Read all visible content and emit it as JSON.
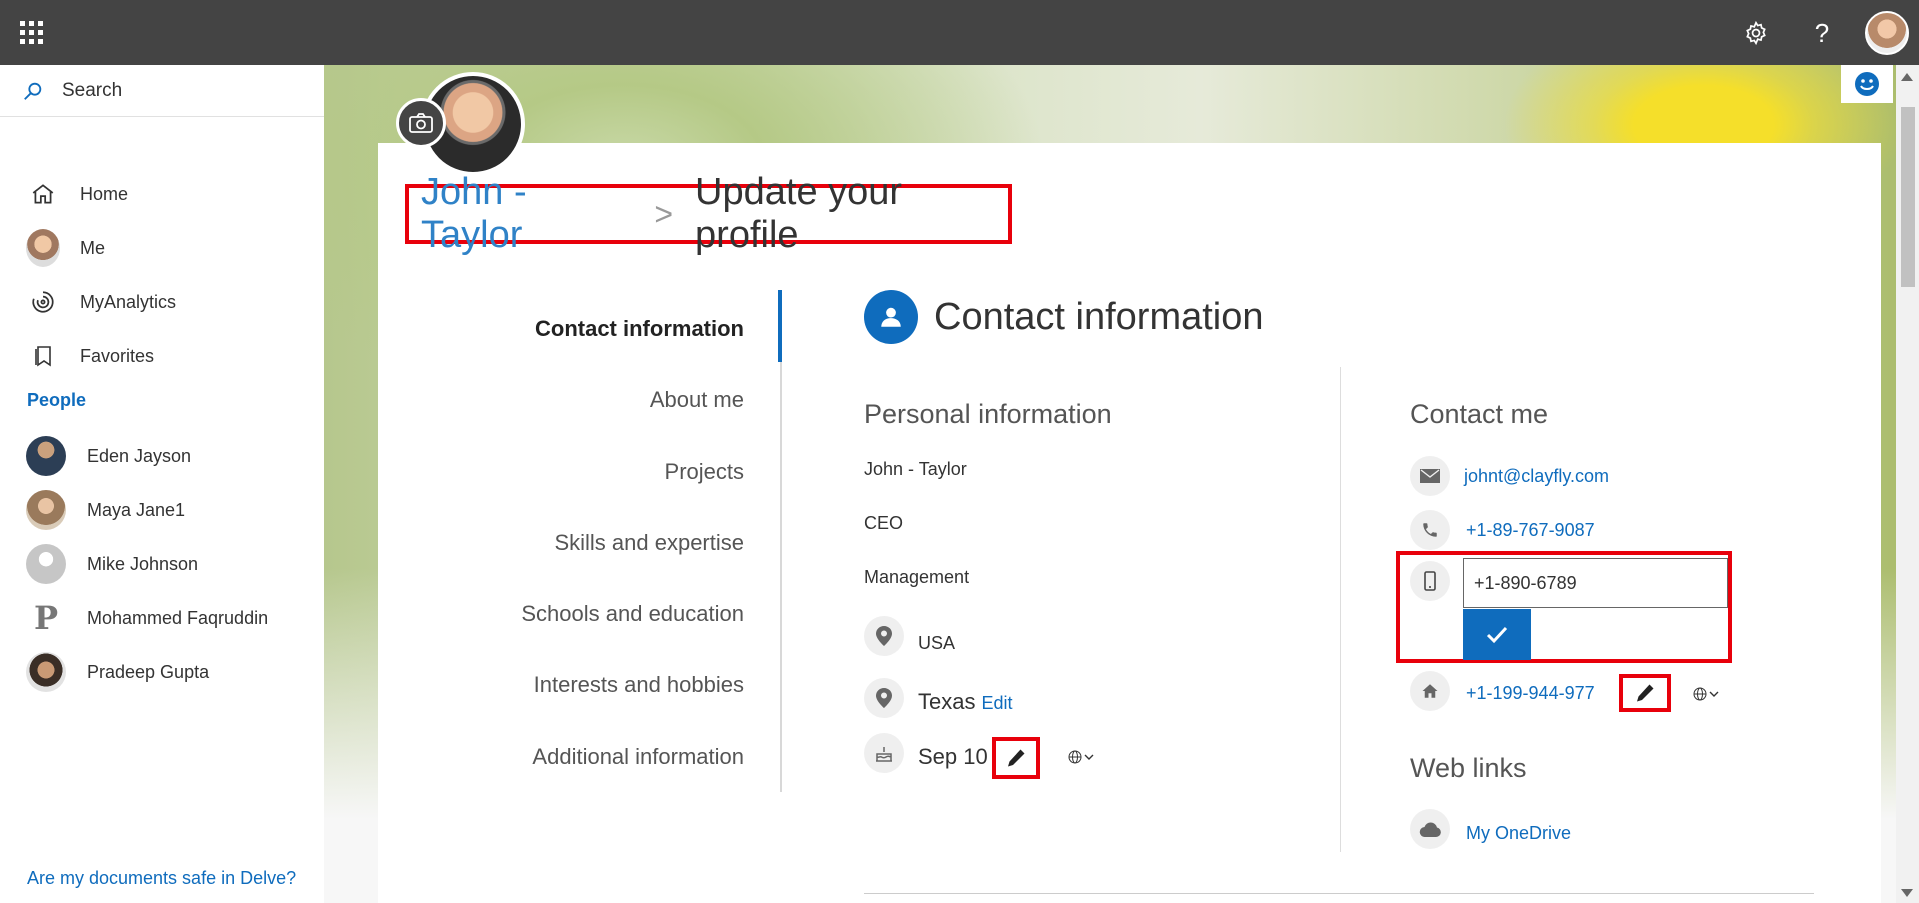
{
  "topbar": {
    "waffle_icon": "waffle-icon",
    "settings_icon": "gear-icon",
    "help_label": "?"
  },
  "sidebar": {
    "search_label": "Search",
    "items": [
      {
        "label": "Home",
        "icon": "home-icon"
      },
      {
        "label": "Me",
        "icon": "avatar"
      },
      {
        "label": "MyAnalytics",
        "icon": "analytics-icon"
      },
      {
        "label": "Favorites",
        "icon": "bookmark-icon"
      }
    ],
    "people_heading": "People",
    "people": [
      {
        "name": "Eden Jayson"
      },
      {
        "name": "Maya Jane1"
      },
      {
        "name": "Mike Johnson"
      },
      {
        "name": "Mohammed Faqruddin"
      },
      {
        "name": "Pradeep Gupta"
      }
    ],
    "footer_link": "Are my documents safe in Delve?"
  },
  "breadcrumb": {
    "name": "John - Taylor",
    "separator": ">",
    "page": "Update your profile"
  },
  "section_nav": [
    {
      "label": "Contact information",
      "active": true
    },
    {
      "label": "About me"
    },
    {
      "label": "Projects"
    },
    {
      "label": "Skills and expertise"
    },
    {
      "label": "Schools and education"
    },
    {
      "label": "Interests and hobbies"
    },
    {
      "label": "Additional information"
    }
  ],
  "content": {
    "title": "Contact information",
    "personal": {
      "heading": "Personal information",
      "name": "John - Taylor",
      "title": "CEO",
      "department": "Management",
      "country": "USA",
      "state": "Texas",
      "state_edit": "Edit",
      "birthday": "Sep 10"
    },
    "contact": {
      "heading": "Contact me",
      "email": "johnt@clayfly.com",
      "work_phone": "+1-89-767-9087",
      "mobile_value": "+1-890-6789",
      "home_phone": "+1-199-944-977"
    },
    "web_links": {
      "heading": "Web links",
      "onedrive": "My OneDrive"
    }
  },
  "colors": {
    "accent": "#0f6cbd",
    "highlight": "#e8000b",
    "topbar": "#444444"
  }
}
